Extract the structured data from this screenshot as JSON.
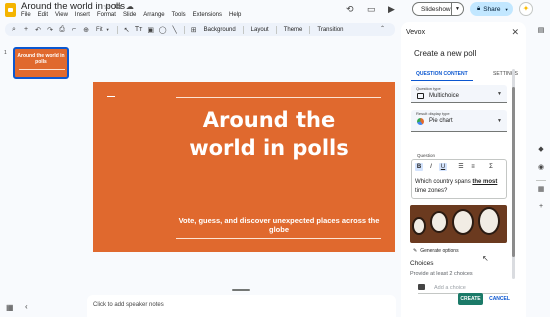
{
  "header": {
    "title": "Around the world in polls",
    "title_icons": [
      "☆",
      "⧉",
      "☁"
    ],
    "menu": [
      "File",
      "Edit",
      "View",
      "Insert",
      "Format",
      "Slide",
      "Arrange",
      "Tools",
      "Extensions",
      "Help"
    ],
    "slideshow_label": "Slideshow",
    "share_label": "Share"
  },
  "toolbar": {
    "zoom_label": "Fit",
    "background_label": "Background",
    "layout_label": "Layout",
    "theme_label": "Theme",
    "transition_label": "Transition"
  },
  "filmstrip": {
    "slide_number": "1",
    "thumb_title": "Around the world in polls"
  },
  "slide": {
    "title": "Around the world in polls",
    "subtitle": "Vote, guess, and discover unexpected places across the globe",
    "background_color": "#e0692e"
  },
  "notes": {
    "placeholder": "Click to add speaker notes"
  },
  "panel": {
    "app_name": "Vevox",
    "pane_title": "Create a new poll",
    "tab_active": "QUESTION CONTENT",
    "tab_other": "SETTINGS",
    "question_type_label": "Question type",
    "question_type_value": "Multichoice",
    "display_type_label": "Result display type",
    "display_type_value": "Pie chart",
    "question_label": "Question",
    "question_text_before": "Which country spans ",
    "question_text_bold": "the most",
    "question_text_after": " time zones?",
    "generate_label": "Generate options",
    "choices_heading": "Choices",
    "choices_hint": "Provide at least 2 choices",
    "add_choice_placeholder": "Add a choice",
    "create_label": "CREATE",
    "cancel_label": "CANCEL",
    "accent_color": "#1b7a68"
  }
}
